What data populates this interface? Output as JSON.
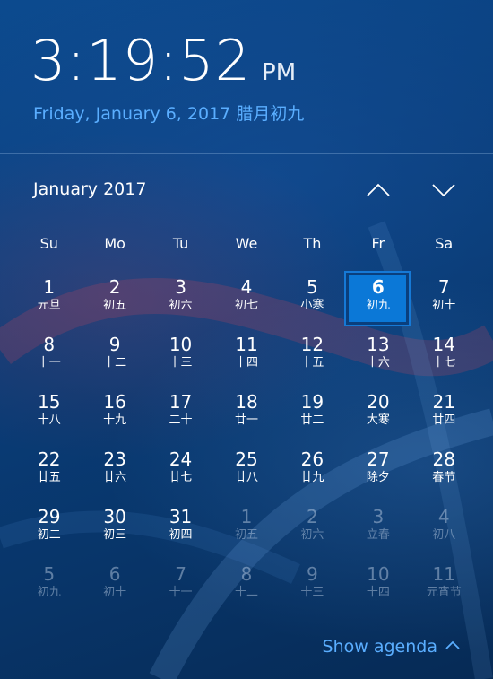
{
  "clock": {
    "time": "3:19:52",
    "ampm": "PM",
    "date": "Friday, January 6, 2017",
    "lunar_date": "腊月初九"
  },
  "calendar": {
    "month_title": "January 2017",
    "weekdays": [
      "Su",
      "Mo",
      "Tu",
      "We",
      "Th",
      "Fr",
      "Sa"
    ],
    "weeks": [
      [
        {
          "day": "1",
          "lunar": "元旦",
          "other": false,
          "today": false
        },
        {
          "day": "2",
          "lunar": "初五",
          "other": false,
          "today": false
        },
        {
          "day": "3",
          "lunar": "初六",
          "other": false,
          "today": false
        },
        {
          "day": "4",
          "lunar": "初七",
          "other": false,
          "today": false
        },
        {
          "day": "5",
          "lunar": "小寒",
          "other": false,
          "today": false
        },
        {
          "day": "6",
          "lunar": "初九",
          "other": false,
          "today": true
        },
        {
          "day": "7",
          "lunar": "初十",
          "other": false,
          "today": false
        }
      ],
      [
        {
          "day": "8",
          "lunar": "十一",
          "other": false,
          "today": false
        },
        {
          "day": "9",
          "lunar": "十二",
          "other": false,
          "today": false
        },
        {
          "day": "10",
          "lunar": "十三",
          "other": false,
          "today": false
        },
        {
          "day": "11",
          "lunar": "十四",
          "other": false,
          "today": false
        },
        {
          "day": "12",
          "lunar": "十五",
          "other": false,
          "today": false
        },
        {
          "day": "13",
          "lunar": "十六",
          "other": false,
          "today": false
        },
        {
          "day": "14",
          "lunar": "十七",
          "other": false,
          "today": false
        }
      ],
      [
        {
          "day": "15",
          "lunar": "十八",
          "other": false,
          "today": false
        },
        {
          "day": "16",
          "lunar": "十九",
          "other": false,
          "today": false
        },
        {
          "day": "17",
          "lunar": "二十",
          "other": false,
          "today": false
        },
        {
          "day": "18",
          "lunar": "廿一",
          "other": false,
          "today": false
        },
        {
          "day": "19",
          "lunar": "廿二",
          "other": false,
          "today": false
        },
        {
          "day": "20",
          "lunar": "大寒",
          "other": false,
          "today": false
        },
        {
          "day": "21",
          "lunar": "廿四",
          "other": false,
          "today": false
        }
      ],
      [
        {
          "day": "22",
          "lunar": "廿五",
          "other": false,
          "today": false
        },
        {
          "day": "23",
          "lunar": "廿六",
          "other": false,
          "today": false
        },
        {
          "day": "24",
          "lunar": "廿七",
          "other": false,
          "today": false
        },
        {
          "day": "25",
          "lunar": "廿八",
          "other": false,
          "today": false
        },
        {
          "day": "26",
          "lunar": "廿九",
          "other": false,
          "today": false
        },
        {
          "day": "27",
          "lunar": "除夕",
          "other": false,
          "today": false
        },
        {
          "day": "28",
          "lunar": "春节",
          "other": false,
          "today": false
        }
      ],
      [
        {
          "day": "29",
          "lunar": "初二",
          "other": false,
          "today": false
        },
        {
          "day": "30",
          "lunar": "初三",
          "other": false,
          "today": false
        },
        {
          "day": "31",
          "lunar": "初四",
          "other": false,
          "today": false
        },
        {
          "day": "1",
          "lunar": "初五",
          "other": true,
          "today": false
        },
        {
          "day": "2",
          "lunar": "初六",
          "other": true,
          "today": false
        },
        {
          "day": "3",
          "lunar": "立春",
          "other": true,
          "today": false
        },
        {
          "day": "4",
          "lunar": "初八",
          "other": true,
          "today": false
        }
      ],
      [
        {
          "day": "5",
          "lunar": "初九",
          "other": true,
          "today": false
        },
        {
          "day": "6",
          "lunar": "初十",
          "other": true,
          "today": false
        },
        {
          "day": "7",
          "lunar": "十一",
          "other": true,
          "today": false
        },
        {
          "day": "8",
          "lunar": "十二",
          "other": true,
          "today": false
        },
        {
          "day": "9",
          "lunar": "十三",
          "other": true,
          "today": false
        },
        {
          "day": "10",
          "lunar": "十四",
          "other": true,
          "today": false
        },
        {
          "day": "11",
          "lunar": "元宵节",
          "other": true,
          "today": false
        }
      ]
    ]
  },
  "navigation": {
    "prev_icon": "chevron-up-icon",
    "next_icon": "chevron-down-icon"
  },
  "agenda": {
    "label": "Show agenda",
    "icon": "chevron-up-icon"
  },
  "colors": {
    "accent": "#5aaeff",
    "today_fill": "#0b78d7",
    "background": "#0a3f7d"
  }
}
